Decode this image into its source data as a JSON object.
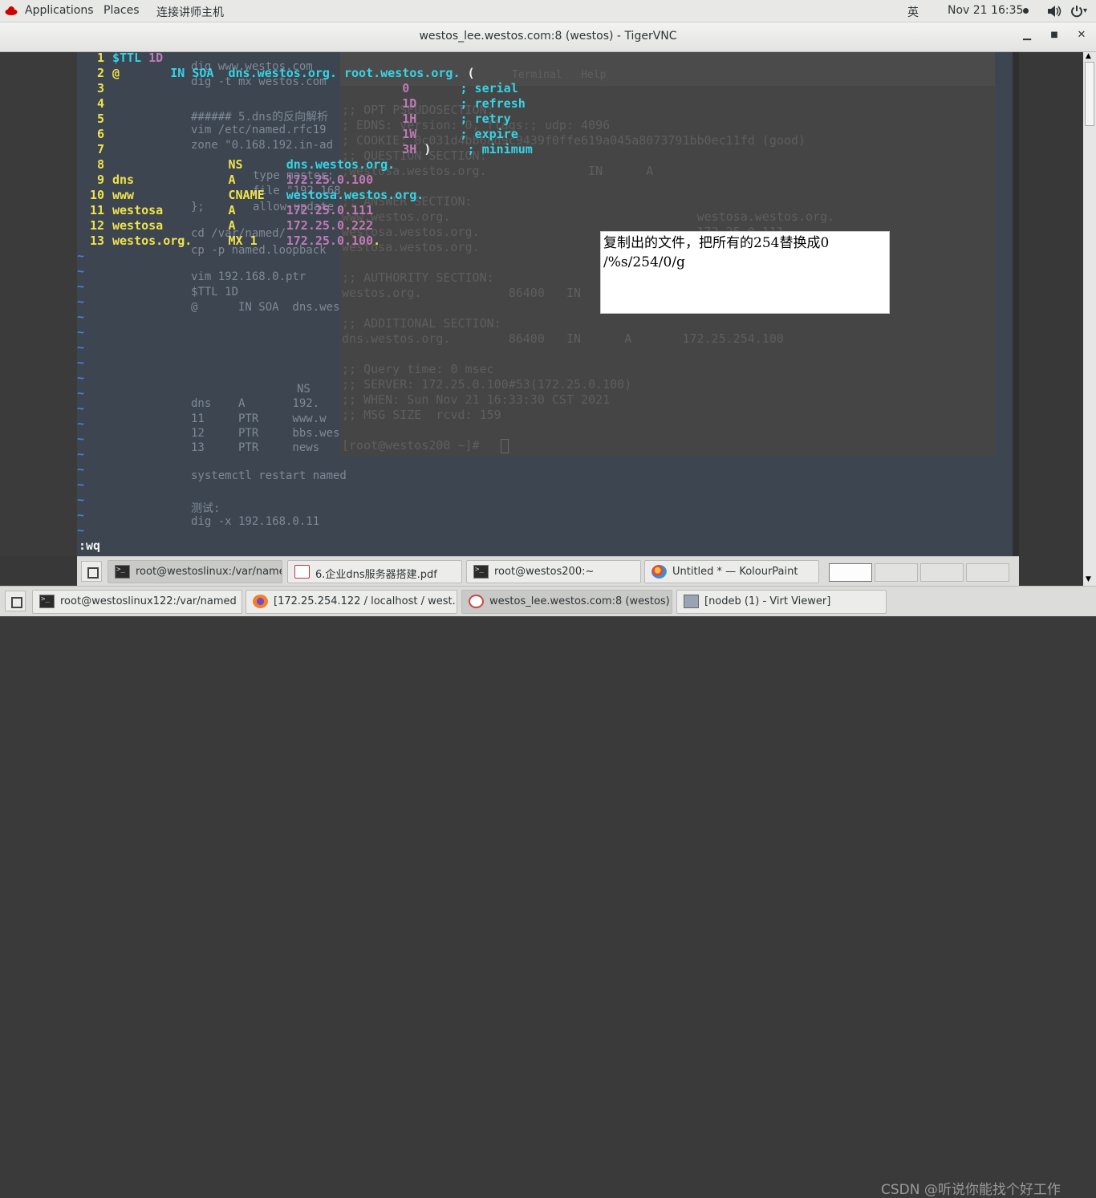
{
  "topbar": {
    "applications": "Applications",
    "places": "Places",
    "connect": "连接讲师主机",
    "input_method": "英",
    "datetime": "Nov 21  16:35",
    "icons": [
      "redhat-icon",
      "record-dot-icon",
      "volume-icon",
      "power-icon"
    ]
  },
  "window": {
    "title": "westos_lee.westos.com:8 (westos) - TigerVNC",
    "buttons": [
      "minimize",
      "maximize",
      "close"
    ]
  },
  "vim": {
    "lines": [
      {
        "n": "1",
        "segs": [
          {
            "t": "$TTL ",
            "c": "cyan"
          },
          {
            "t": "1D",
            "c": "mag"
          }
        ]
      },
      {
        "n": "2",
        "segs": [
          {
            "t": "@",
            "c": "yellow"
          },
          {
            "t": "       IN SOA  ",
            "c": "cyan"
          },
          {
            "t": "dns.westos.org.",
            "c": "cyan"
          },
          {
            "t": " root.westos.org.",
            "c": "cyan"
          },
          {
            "t": " (",
            "c": "white"
          }
        ]
      },
      {
        "n": "3",
        "segs": [
          {
            "t": "                                        0       ",
            "c": "mag"
          },
          {
            "t": "; serial",
            "c": "cyan"
          }
        ]
      },
      {
        "n": "4",
        "segs": [
          {
            "t": "                                        1D      ",
            "c": "mag"
          },
          {
            "t": "; refresh",
            "c": "cyan"
          }
        ]
      },
      {
        "n": "5",
        "segs": [
          {
            "t": "                                        1H      ",
            "c": "mag"
          },
          {
            "t": "; retry",
            "c": "cyan"
          }
        ]
      },
      {
        "n": "6",
        "segs": [
          {
            "t": "                                        1W      ",
            "c": "mag"
          },
          {
            "t": "; expire",
            "c": "cyan"
          }
        ]
      },
      {
        "n": "7",
        "segs": [
          {
            "t": "                                        3H ",
            "c": "mag"
          },
          {
            "t": ")",
            "c": "white"
          },
          {
            "t": "     ; minimum",
            "c": "cyan"
          }
        ]
      },
      {
        "n": "8",
        "segs": [
          {
            "t": "                ",
            "c": "white"
          },
          {
            "t": "NS",
            "c": "yellow"
          },
          {
            "t": "      dns.westos.org.",
            "c": "cyan"
          }
        ]
      },
      {
        "n": "9",
        "segs": [
          {
            "t": "dns",
            "c": "yellow"
          },
          {
            "t": "             ",
            "c": "white"
          },
          {
            "t": "A",
            "c": "yellow"
          },
          {
            "t": "       172.25.0.100",
            "c": "mag"
          }
        ]
      },
      {
        "n": "10",
        "segs": [
          {
            "t": "www",
            "c": "yellow"
          },
          {
            "t": "             ",
            "c": "white"
          },
          {
            "t": "CNAME",
            "c": "yellow"
          },
          {
            "t": "   westosa.westos.org.",
            "c": "cyan"
          }
        ]
      },
      {
        "n": "11",
        "segs": [
          {
            "t": "westosa",
            "c": "yellow"
          },
          {
            "t": "         ",
            "c": "white"
          },
          {
            "t": "A",
            "c": "yellow"
          },
          {
            "t": "       172.25.0.111",
            "c": "mag"
          }
        ]
      },
      {
        "n": "12",
        "segs": [
          {
            "t": "westosa",
            "c": "yellow"
          },
          {
            "t": "         ",
            "c": "white"
          },
          {
            "t": "A",
            "c": "yellow"
          },
          {
            "t": "       172.25.0.222",
            "c": "mag"
          }
        ]
      },
      {
        "n": "13",
        "segs": [
          {
            "t": "westos.org.",
            "c": "yellow"
          },
          {
            "t": "     ",
            "c": "white"
          },
          {
            "t": "MX 1",
            "c": "yellow"
          },
          {
            "t": "    172.25.0.100",
            "c": "mag"
          },
          {
            "t": ".",
            "c": "yellow"
          }
        ]
      }
    ],
    "tilde": "~",
    "command": ":wq"
  },
  "background_text": {
    "notes": [
      "dig www.westos.com",
      "dig -t mx westos.com",
      "###### 5.dns的反向解析",
      "vim /etc/named.rfc19",
      "zone \"0.168.192.in-ad",
      "       type master;",
      "       file \"192.168.0.",
      "       allow-update",
      "};",
      "cd /var/named/",
      "cp -p named.loopback",
      "vim 192.168.0.ptr",
      "$TTL 1D",
      "@      IN SOA  dns.westos.com. root.westos.com. (",
      "       NS      dns.",
      "dns    A       192.",
      "11     PTR     www.w",
      "12     PTR     bbs.westos.com.",
      "13     PTR     news",
      "systemctl restart named",
      "测试:",
      "dig -x 192.168.0.11"
    ],
    "terminal": [
      ";; OPT PSEUDOSECTION:",
      "; EDNS: version: 0, flags:; udp: 4096",
      "; COOKIE: 0c031d4bb6ad9c9439f0ffe619a045a8073791bb0ec11fd (good)",
      ";; QUESTION SECTION:",
      ";westosa.westos.org.              IN      A",
      ";; ANSWER SECTION:",
      "www.westos.org.                                  westosa.westos.org.",
      "westosa.westos.org.                              172.25.0.111",
      "westosa.westos.org.                              172.25.0.222",
      ";; AUTHORITY SECTION:",
      "westos.org.            86400   IN      NS      dns.westos.org.",
      ";; ADDITIONAL SECTION:",
      "dns.westos.org.        86400   IN      A       172.25.254.100",
      ";; Query time: 0 msec",
      ";; SERVER: 172.25.0.100#53(172.25.0.100)",
      ";; WHEN: Sun Nov 21 16:33:30 CST 2021",
      ";; MSG SIZE  rcvd: 159",
      "[root@westos200 ~]# "
    ],
    "term_menu": "Terminal   Help"
  },
  "note": {
    "line1": "复制出的文件，把所有的254替换成0",
    "line2": "/%s/254/0/g"
  },
  "inner_taskbar": {
    "items": [
      {
        "label": "root@westoslinux:/var/named",
        "icon": "terminal-icon",
        "active": true
      },
      {
        "label": "6.企业dns服务器搭建.pdf",
        "icon": "pdf-icon",
        "active": false
      },
      {
        "label": "root@westos200:~",
        "icon": "terminal-icon",
        "active": false
      },
      {
        "label": "Untitled * — KolourPaint",
        "icon": "kolourpaint-icon",
        "active": false
      }
    ],
    "workspaces": 4
  },
  "outer_taskbar": {
    "items": [
      {
        "label": "root@westoslinux122:/var/named",
        "icon": "terminal-icon",
        "active": false
      },
      {
        "label": "[172.25.254.122 / localhost / west...",
        "icon": "firefox-icon",
        "active": false
      },
      {
        "label": "westos_lee.westos.com:8 (westos) ...",
        "icon": "tigervnc-icon",
        "active": true
      },
      {
        "label": "[nodeb (1) - Virt Viewer]",
        "icon": "virt-viewer-icon",
        "active": false
      }
    ]
  },
  "watermark": "CSDN @听说你能找个好工作",
  "colors": {
    "vim_bg": "#3c4550",
    "yellow": "#f0e34c",
    "cyan": "#37d4e6",
    "magenta": "#c07ab8",
    "tilde": "#4d7fd4"
  }
}
